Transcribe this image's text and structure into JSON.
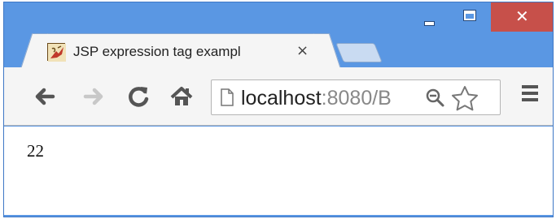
{
  "window": {
    "minimize_label": "minimize",
    "maximize_label": "maximize",
    "close_glyph": "✕"
  },
  "tab": {
    "title": "JSP expression tag exampl",
    "close_glyph": "×",
    "favicon": "java-coffee-icon"
  },
  "toolbar": {
    "back_icon": "back-arrow-icon",
    "forward_icon": "forward-arrow-icon",
    "reload_icon": "reload-icon",
    "home_icon": "home-icon",
    "menu_icon": "hamburger-menu-icon"
  },
  "omnibox": {
    "url_host": "localhost",
    "url_rest": ":8080/B",
    "page_icon": "document-icon",
    "zoom_icon": "magnifier-minus-icon",
    "bookmark_icon": "star-outline-icon"
  },
  "page": {
    "output": "22"
  },
  "colors": {
    "frame": "#5a97e3",
    "close_button": "#c7504a",
    "toolbar": "#f5f5f5"
  }
}
